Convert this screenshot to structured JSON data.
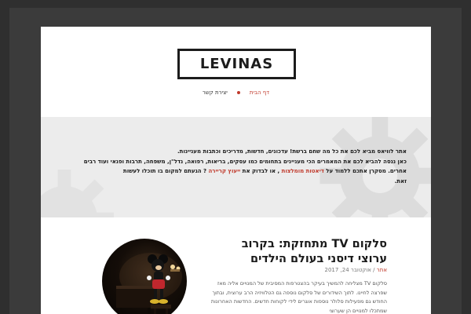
{
  "site": {
    "logo": "LEVINAS"
  },
  "nav": {
    "items": [
      {
        "label": "דף הבית"
      },
      {
        "label": "יצירת קשר"
      }
    ]
  },
  "hero": {
    "line1": "אתר לוויאס מביא לכם את כל מה שחם ברשת! עדכונים, חדשות, מדריכים וכתבות מעניינות.",
    "line2_a": "כאן ננסה להביא לכם את המאמרים הכי מעניינים בתחומים כמו עסקים, בריאות, רפואה, נדל\"ן, משפחה, תרבות ופנאי ועוד רבים",
    "line3_a": "אחרים. מסקרן אתכם ללמוד על ",
    "link1": "דיאטות מומלצות",
    "line3_b": " , או לבדוק ",
    "line3_c": "את ",
    "link2": "ייעוץ קריירה",
    "line3_d": " ? הגעתם למקום בו תוכלו לעשות",
    "line4": "זאת."
  },
  "post": {
    "title": "סלקום TV מתחזקת: בקרוב ערוצי דיסני בעולם הילדים",
    "date": "אוקטובר 24, 2017",
    "author": "אתר",
    "excerpt": "סלקום TV מצליחה להמשיך בעיקר בהצטרפות המסיבית של המנויים אליה מאז שפרצה לחיינו. לתוך השידורים של סלקום נוספה גם הטלוויזיה הרב ערוצית, ובתוך החודש גם מפעילות סלולר נוספות אוגרים לידי לקוחות חדשים. החדשות האחרונות שמתכלו למנויים הן שערוצי"
  }
}
